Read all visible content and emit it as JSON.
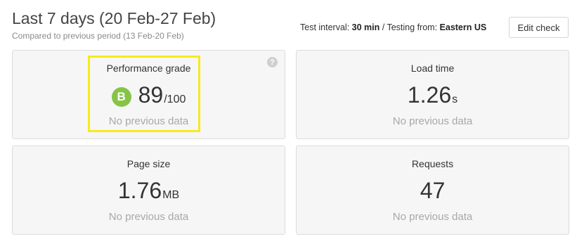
{
  "header": {
    "title": "Last 7 days (20 Feb-27 Feb)",
    "subtitle": "Compared to previous period (13 Feb-20 Feb)",
    "test_interval_label": "Test interval:",
    "test_interval_value": "30 min",
    "separator": "/",
    "testing_from_label": "Testing from:",
    "testing_from_value": "Eastern US",
    "edit_button": "Edit check"
  },
  "cards": {
    "performance": {
      "label": "Performance grade",
      "grade": "B",
      "value": "89",
      "unit": "/100",
      "previous": "No previous data",
      "help": "?"
    },
    "load_time": {
      "label": "Load time",
      "value": "1.26",
      "unit": "s",
      "previous": "No previous data"
    },
    "page_size": {
      "label": "Page size",
      "value": "1.76",
      "unit": "MB",
      "previous": "No previous data"
    },
    "requests": {
      "label": "Requests",
      "value": "47",
      "previous": "No previous data"
    }
  },
  "colors": {
    "grade_badge": "#86c447",
    "highlight": "#f7ea1c"
  },
  "icons": {
    "help": "help-icon"
  }
}
